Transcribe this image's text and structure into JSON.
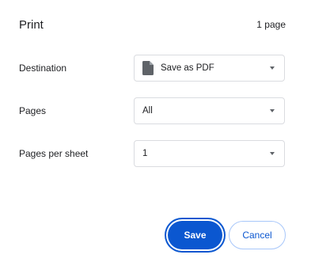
{
  "header": {
    "title": "Print",
    "page_count": "1 page"
  },
  "settings": {
    "destination": {
      "label": "Destination",
      "value": "Save as PDF",
      "icon": "file-icon"
    },
    "pages": {
      "label": "Pages",
      "value": "All"
    },
    "pages_per_sheet": {
      "label": "Pages per sheet",
      "value": "1"
    }
  },
  "actions": {
    "save_label": "Save",
    "cancel_label": "Cancel"
  },
  "colors": {
    "accent": "#0b57d0",
    "border": "#dadce0",
    "text": "#202124"
  }
}
